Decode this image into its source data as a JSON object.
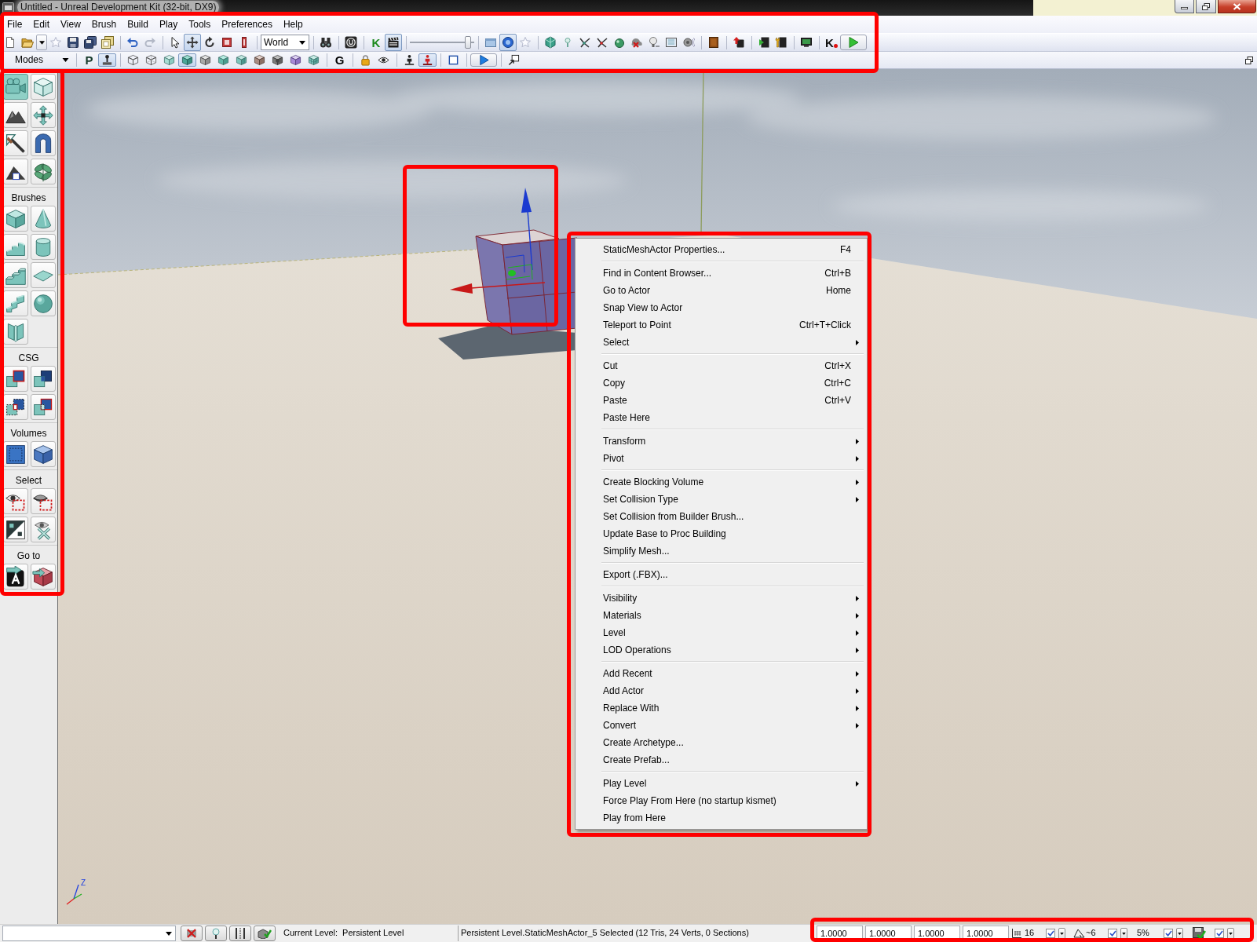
{
  "window": {
    "title": "Untitled - Unreal Development Kit (32-bit, DX9)"
  },
  "menu_bar": {
    "items": [
      "File",
      "Edit",
      "View",
      "Brush",
      "Build",
      "Play",
      "Tools",
      "Preferences",
      "Help"
    ]
  },
  "toolbars": {
    "highlighted": true,
    "main": [
      {
        "kind": "button",
        "pressed": false
      },
      {
        "kind": "button",
        "pressed": false
      },
      {
        "kind": "caret"
      },
      {
        "kind": "button",
        "pressed": false
      },
      {
        "kind": "button",
        "pressed": false
      },
      {
        "kind": "button",
        "pressed": false
      },
      {
        "kind": "button",
        "pressed": false
      },
      {
        "kind": "separator"
      },
      {
        "kind": "button",
        "pressed": false
      },
      {
        "kind": "button",
        "pressed": false
      },
      {
        "kind": "separator"
      },
      {
        "kind": "button",
        "pressed": false
      },
      {
        "kind": "button",
        "pressed": true
      },
      {
        "kind": "button",
        "pressed": false
      },
      {
        "kind": "button",
        "pressed": false
      },
      {
        "kind": "button",
        "pressed": false
      },
      {
        "kind": "separator"
      },
      {
        "kind": "combo",
        "value": "World"
      },
      {
        "kind": "separator"
      },
      {
        "kind": "button",
        "pressed": false
      },
      {
        "kind": "separator"
      },
      {
        "kind": "button",
        "pressed": false
      },
      {
        "kind": "separator"
      },
      {
        "kind": "letter",
        "glyph": "K",
        "pressed": false
      },
      {
        "kind": "button",
        "pressed": true
      },
      {
        "kind": "separator"
      },
      {
        "kind": "slider",
        "level": 0.95
      },
      {
        "kind": "separator"
      },
      {
        "kind": "button",
        "pressed": false
      },
      {
        "kind": "button",
        "pressed": true
      },
      {
        "kind": "button",
        "pressed": false
      },
      {
        "kind": "separator"
      },
      {
        "kind": "button",
        "pressed": false
      },
      {
        "kind": "button",
        "pressed": false
      },
      {
        "kind": "button",
        "pressed": false
      },
      {
        "kind": "button",
        "pressed": false
      },
      {
        "kind": "button",
        "pressed": false
      },
      {
        "kind": "button",
        "pressed": false
      },
      {
        "kind": "button",
        "pressed": false
      },
      {
        "kind": "button",
        "pressed": false
      },
      {
        "kind": "button",
        "pressed": false
      },
      {
        "kind": "separator"
      },
      {
        "kind": "button",
        "pressed": false
      },
      {
        "kind": "separator"
      },
      {
        "kind": "button",
        "pressed": false
      },
      {
        "kind": "separator"
      },
      {
        "kind": "button",
        "pressed": false
      },
      {
        "kind": "button",
        "pressed": false
      },
      {
        "kind": "separator"
      },
      {
        "kind": "button",
        "pressed": false
      },
      {
        "kind": "separator"
      },
      {
        "kind": "letter",
        "glyph": "K",
        "pressed": false
      },
      {
        "kind": "wide",
        "pressed": false
      }
    ],
    "modes": [
      {
        "kind": "menu",
        "label": "Modes"
      },
      {
        "kind": "separator"
      },
      {
        "kind": "letter",
        "glyph": "P",
        "pressed": false
      },
      {
        "kind": "button",
        "pressed": true
      },
      {
        "kind": "separator"
      },
      {
        "kind": "button",
        "pressed": false
      },
      {
        "kind": "button",
        "pressed": false
      },
      {
        "kind": "button",
        "pressed": false
      },
      {
        "kind": "button",
        "pressed": true
      },
      {
        "kind": "button",
        "pressed": false
      },
      {
        "kind": "button",
        "pressed": false
      },
      {
        "kind": "button",
        "pressed": false
      },
      {
        "kind": "button",
        "pressed": false
      },
      {
        "kind": "button",
        "pressed": false
      },
      {
        "kind": "button",
        "pressed": false
      },
      {
        "kind": "button",
        "pressed": false
      },
      {
        "kind": "separator"
      },
      {
        "kind": "letter",
        "glyph": "G",
        "pressed": false
      },
      {
        "kind": "separator"
      },
      {
        "kind": "button",
        "pressed": false
      },
      {
        "kind": "button",
        "pressed": false
      },
      {
        "kind": "separator"
      },
      {
        "kind": "button",
        "pressed": false
      },
      {
        "kind": "button",
        "pressed": true
      },
      {
        "kind": "separator"
      },
      {
        "kind": "button",
        "pressed": false
      },
      {
        "kind": "separator"
      },
      {
        "kind": "wide",
        "pressed": false
      },
      {
        "kind": "separator"
      },
      {
        "kind": "button",
        "pressed": false
      }
    ]
  },
  "modes_panel": {
    "highlighted": true,
    "groups": [
      {
        "buttons": [
          {
            "selected": true
          },
          {
            "selected": false
          },
          {
            "selected": false
          },
          {
            "selected": false
          },
          {
            "selected": false
          },
          {
            "selected": false
          },
          {
            "selected": false
          },
          {
            "selected": false
          }
        ]
      },
      {
        "label": "Brushes",
        "buttons": [
          {
            "selected": false
          },
          {
            "selected": false
          },
          {
            "selected": false
          },
          {
            "selected": false
          },
          {
            "selected": false
          },
          {
            "selected": false
          },
          {
            "selected": false
          },
          {
            "selected": false
          },
          {
            "selected": false
          }
        ]
      },
      {
        "label": "CSG",
        "buttons": [
          {
            "selected": false
          },
          {
            "selected": false
          },
          {
            "selected": false
          },
          {
            "selected": false
          }
        ]
      },
      {
        "label": "Volumes",
        "buttons": [
          {
            "selected": false
          },
          {
            "selected": false
          }
        ]
      },
      {
        "label": "Select",
        "buttons": [
          {
            "selected": false
          },
          {
            "selected": false
          },
          {
            "selected": false
          },
          {
            "selected": false
          }
        ]
      },
      {
        "label": "Go to",
        "buttons": [
          {
            "selected": false
          },
          {
            "selected": false
          }
        ]
      }
    ]
  },
  "viewport": {
    "axis_label": "Z",
    "gizmo": {
      "highlighted": true
    }
  },
  "context_menu": {
    "highlighted": true,
    "items": [
      {
        "kind": "item",
        "label": "StaticMeshActor Properties...",
        "shortcut": "F4",
        "submenu": false
      },
      {
        "kind": "separator"
      },
      {
        "kind": "item",
        "label": "Find in Content Browser...",
        "shortcut": "Ctrl+B",
        "submenu": false
      },
      {
        "kind": "item",
        "label": "Go to Actor",
        "shortcut": "Home",
        "submenu": false
      },
      {
        "kind": "item",
        "label": "Snap View to Actor",
        "submenu": false
      },
      {
        "kind": "item",
        "label": "Teleport to Point",
        "shortcut": "Ctrl+T+Click",
        "submenu": false
      },
      {
        "kind": "item",
        "label": "Select",
        "submenu": true
      },
      {
        "kind": "separator"
      },
      {
        "kind": "item",
        "label": "Cut",
        "shortcut": "Ctrl+X",
        "submenu": false
      },
      {
        "kind": "item",
        "label": "Copy",
        "shortcut": "Ctrl+C",
        "submenu": false
      },
      {
        "kind": "item",
        "label": "Paste",
        "shortcut": "Ctrl+V",
        "submenu": false
      },
      {
        "kind": "item",
        "label": "Paste Here",
        "submenu": false
      },
      {
        "kind": "separator"
      },
      {
        "kind": "item",
        "label": "Transform",
        "submenu": true
      },
      {
        "kind": "item",
        "label": "Pivot",
        "submenu": true
      },
      {
        "kind": "separator"
      },
      {
        "kind": "item",
        "label": "Create Blocking Volume",
        "submenu": true
      },
      {
        "kind": "item",
        "label": "Set Collision Type",
        "submenu": true
      },
      {
        "kind": "item",
        "label": "Set Collision from Builder Brush...",
        "submenu": false
      },
      {
        "kind": "item",
        "label": "Update Base to Proc Building",
        "submenu": false
      },
      {
        "kind": "item",
        "label": "Simplify Mesh...",
        "submenu": false
      },
      {
        "kind": "separator"
      },
      {
        "kind": "item",
        "label": "Export (.FBX)...",
        "submenu": false
      },
      {
        "kind": "separator"
      },
      {
        "kind": "item",
        "label": "Visibility",
        "submenu": true
      },
      {
        "kind": "item",
        "label": "Materials",
        "submenu": true
      },
      {
        "kind": "item",
        "label": "Level",
        "submenu": true
      },
      {
        "kind": "item",
        "label": "LOD Operations",
        "submenu": true
      },
      {
        "kind": "separator"
      },
      {
        "kind": "item",
        "label": "Add Recent",
        "submenu": true
      },
      {
        "kind": "item",
        "label": "Add Actor",
        "submenu": true
      },
      {
        "kind": "item",
        "label": "Replace With",
        "submenu": true
      },
      {
        "kind": "item",
        "label": "Convert",
        "submenu": true
      },
      {
        "kind": "item",
        "label": "Create Archetype...",
        "submenu": false
      },
      {
        "kind": "item",
        "label": "Create Prefab...",
        "submenu": false
      },
      {
        "kind": "separator"
      },
      {
        "kind": "item",
        "label": "Play Level",
        "submenu": true
      },
      {
        "kind": "item",
        "label": "Force Play From Here (no startup kismet)",
        "submenu": false
      },
      {
        "kind": "item",
        "label": "Play from Here",
        "submenu": false
      }
    ]
  },
  "status_bar": {
    "toggles": [
      {
        "pressed": false
      },
      {
        "pressed": false
      },
      {
        "pressed": false
      },
      {
        "pressed": false
      }
    ],
    "current_level_label": "Current Level:",
    "current_level": "Persistent Level",
    "selection": "Persistent Level.StaticMeshActor_5 Selected (12 Tris, 24 Verts, 0 Sections)",
    "highlighted": true,
    "fields": [
      "1.0000",
      "1.0000",
      "1.0000",
      "1.0000"
    ],
    "snaps": [
      {
        "kind": "grid",
        "value": "16",
        "checked": true
      },
      {
        "kind": "rotation",
        "value": "~6",
        "checked": true
      },
      {
        "kind": "scale",
        "value": "5%",
        "checked": true
      },
      {
        "kind": "autosave",
        "checked": true
      }
    ]
  }
}
